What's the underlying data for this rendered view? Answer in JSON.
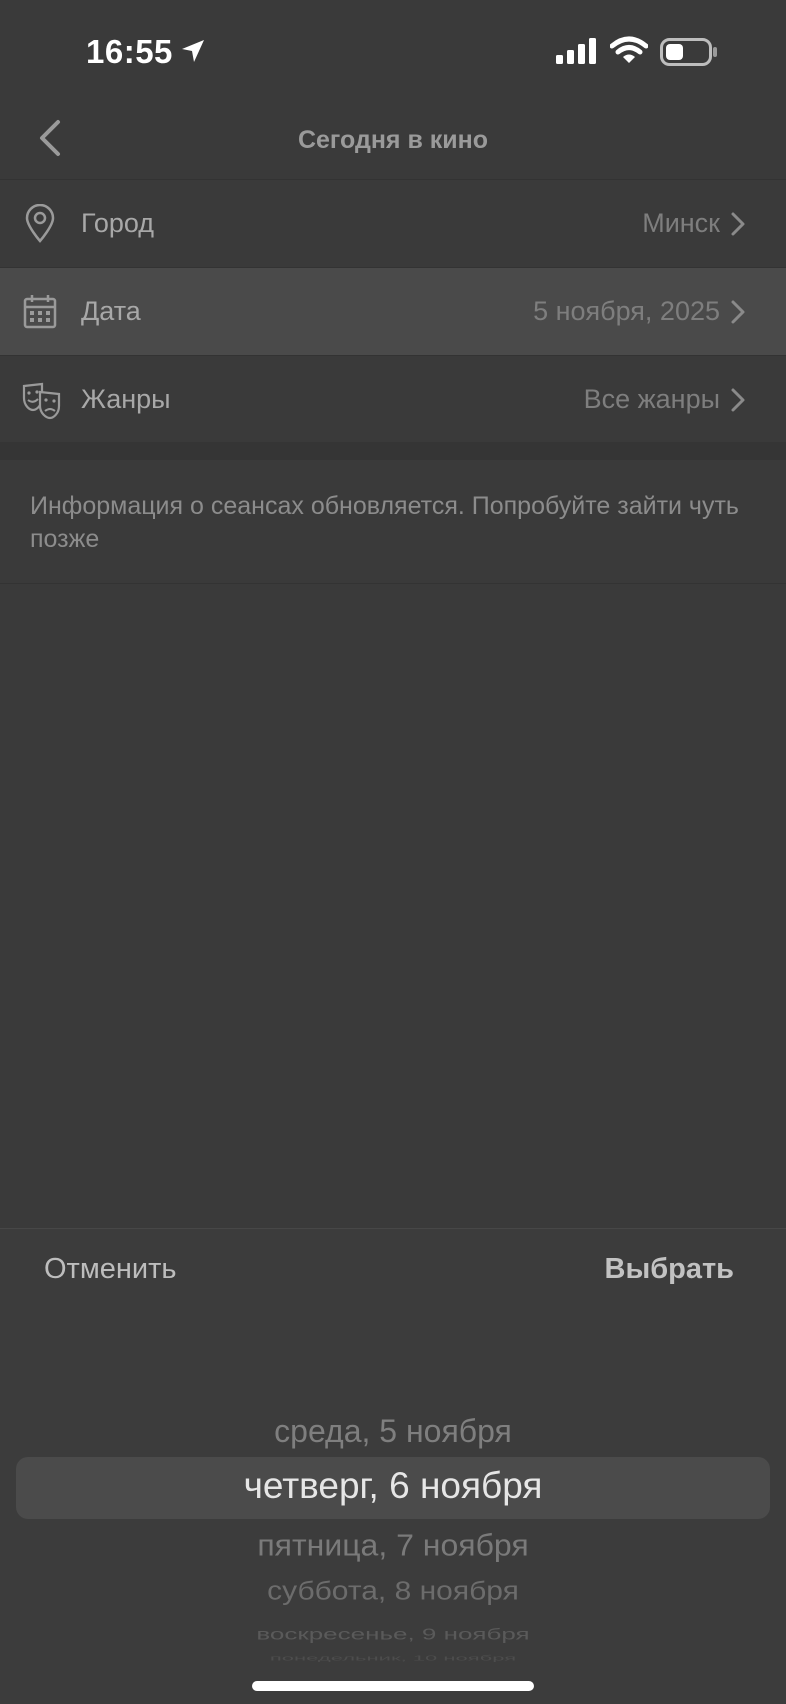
{
  "status_bar": {
    "time": "16:55",
    "icons": [
      "location-arrow-icon",
      "cellular-signal-icon",
      "wifi-icon",
      "battery-icon"
    ]
  },
  "nav": {
    "title": "Сегодня в кино",
    "back_icon": "chevron-left-icon"
  },
  "filters": [
    {
      "icon": "map-pin-icon",
      "label": "Город",
      "value": "Минск"
    },
    {
      "icon": "calendar-icon",
      "label": "Дата",
      "value": "5 ноября, 2025"
    },
    {
      "icon": "theater-masks-icon",
      "label": "Жанры",
      "value": "Все жанры"
    }
  ],
  "info": {
    "message": "Информация о сеансах обновляется. Попробуйте зайти чуть позже"
  },
  "picker": {
    "cancel_label": "Отменить",
    "select_label": "Выбрать",
    "options": [
      "среда, 5 ноября",
      "четверг, 6 ноября",
      "пятница, 7 ноября",
      "суббота, 8 ноября",
      "воскресенье, 9 ноября",
      "понедельник, 10 ноября"
    ],
    "selected": "четверг, 6 ноября"
  },
  "colors": {
    "background": "#3a3a3a",
    "highlight_row": "#4a4a4a",
    "selected_band": "#4b4b4b"
  }
}
